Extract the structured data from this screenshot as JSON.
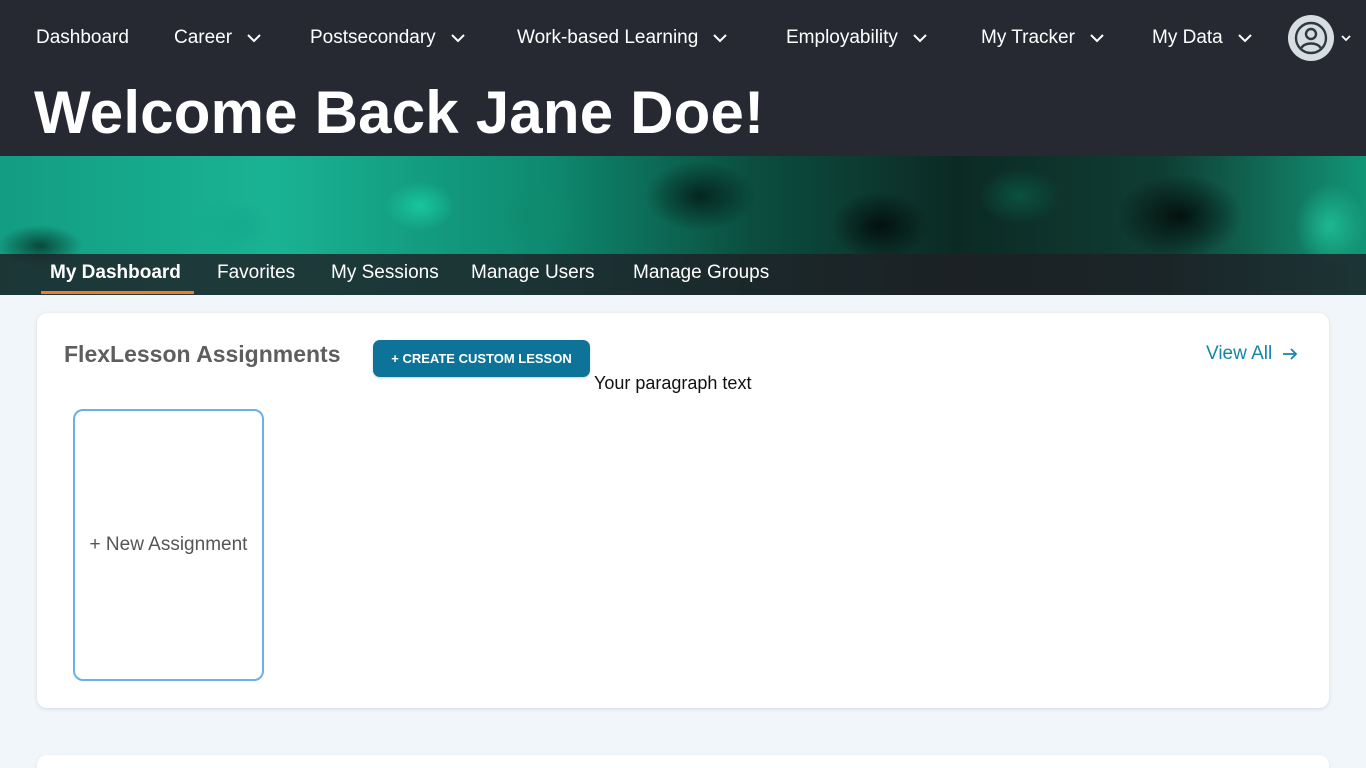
{
  "nav": {
    "items": [
      {
        "label": "Dashboard",
        "has_dropdown": false
      },
      {
        "label": "Career",
        "has_dropdown": true
      },
      {
        "label": "Postsecondary",
        "has_dropdown": true
      },
      {
        "label": "Work-based Learning",
        "has_dropdown": true
      },
      {
        "label": "Employability",
        "has_dropdown": true
      },
      {
        "label": "My Tracker",
        "has_dropdown": true
      },
      {
        "label": "My Data",
        "has_dropdown": true
      }
    ],
    "avatar_icon": "user-circle-icon"
  },
  "header": {
    "welcome": "Welcome Back Jane Doe!"
  },
  "tabs": [
    {
      "label": "My Dashboard",
      "active": true
    },
    {
      "label": "Favorites",
      "active": false
    },
    {
      "label": "My Sessions",
      "active": false
    },
    {
      "label": "Manage Users",
      "active": false
    },
    {
      "label": "Manage Groups",
      "active": false
    }
  ],
  "assignments": {
    "title": "FlexLesson Assignments",
    "create_label": "+ CREATE CUSTOM LESSON",
    "paragraph": "Your paragraph text",
    "view_all_label": "View All",
    "new_assignment_label": "+ New Assignment"
  },
  "colors": {
    "header_bg": "#262932",
    "accent_teal": "#0d7398",
    "link": "#1486a8",
    "active_tab_underline": "#f27a2a",
    "card_border": "#6ab1e7",
    "page_bg": "#f1f6fa"
  }
}
